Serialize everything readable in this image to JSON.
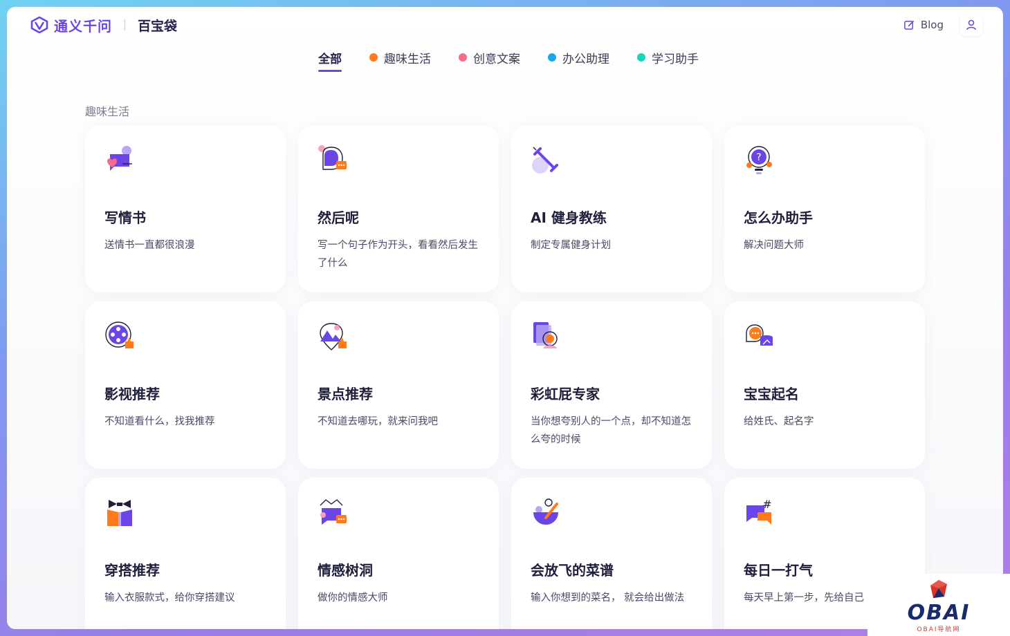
{
  "header": {
    "brand_name": "通义千问",
    "brand_sub": "百宝袋",
    "blog_label": "Blog"
  },
  "tabs": [
    {
      "label": "全部",
      "color": "",
      "active": true
    },
    {
      "label": "趣味生活",
      "color": "#ff7a1a",
      "active": false
    },
    {
      "label": "创意文案",
      "color": "#f76b8a",
      "active": false
    },
    {
      "label": "办公助理",
      "color": "#1aa7ec",
      "active": false
    },
    {
      "label": "学习助手",
      "color": "#18d4c0",
      "active": false
    }
  ],
  "section": {
    "title": "趣味生活"
  },
  "cards": [
    {
      "title": "写情书",
      "desc": "送情书一直都很浪漫",
      "icon": "love-letter-icon"
    },
    {
      "title": "然后呢",
      "desc": "写一个句子作为开头，看看然后发生了什么",
      "icon": "chat-bubble-icon"
    },
    {
      "title": "AI 健身教练",
      "desc": "制定专属健身计划",
      "icon": "dumbbell-icon"
    },
    {
      "title": "怎么办助手",
      "desc": "解决问题大师",
      "icon": "lightbulb-question-icon"
    },
    {
      "title": "影视推荐",
      "desc": "不知道看什么，找我推荐",
      "icon": "film-reel-icon"
    },
    {
      "title": "景点推荐",
      "desc": "不知道去哪玩，就来问我吧",
      "icon": "map-pin-icon"
    },
    {
      "title": "彩虹屁专家",
      "desc": "当你想夸别人的一个点，却不知道怎么夸的时候",
      "icon": "compliment-icon"
    },
    {
      "title": "宝宝起名",
      "desc": "给姓氏、起名字",
      "icon": "baby-name-icon"
    },
    {
      "title": "穿搭推荐",
      "desc": "输入衣服款式，给你穿搭建议",
      "icon": "outfit-icon"
    },
    {
      "title": "情感树洞",
      "desc": "做你的情感大师",
      "icon": "emotion-chat-icon"
    },
    {
      "title": "会放飞的菜谱",
      "desc": "输入你想到的菜名， 就会给出做法",
      "icon": "recipe-bowl-icon"
    },
    {
      "title": "每日一打气",
      "desc": "每天早上第一步，先给自己",
      "icon": "cheer-hashtag-icon"
    }
  ],
  "watermark": {
    "text": "OBAI",
    "sub": "OBAI导航网"
  },
  "colors": {
    "accent": "#6b45e8",
    "orange": "#ff7a1a",
    "purple": "#6b45e8"
  }
}
